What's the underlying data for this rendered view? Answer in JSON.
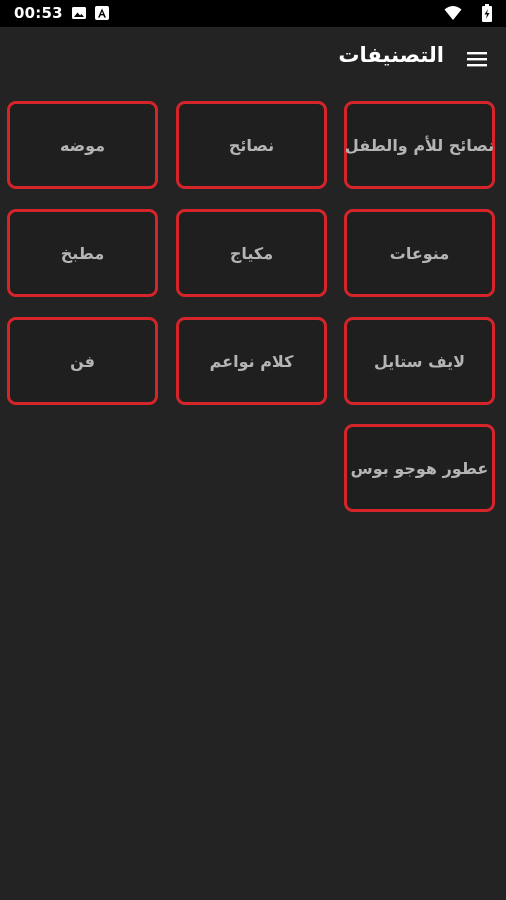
{
  "status_bar": {
    "time": "00:53",
    "icons": [
      "image-icon",
      "notification-a-icon",
      "wifi-icon",
      "battery-icon"
    ]
  },
  "app_bar": {
    "title": "التصنيفات",
    "menu_icon": "hamburger-menu-icon"
  },
  "categories": [
    {
      "label": "نصائح للأم والطفل"
    },
    {
      "label": "نصائح"
    },
    {
      "label": "موضه"
    },
    {
      "label": "منوعات"
    },
    {
      "label": "مكياج"
    },
    {
      "label": "مطبخ"
    },
    {
      "label": "لايف ستايل"
    },
    {
      "label": "كلام نواعم"
    },
    {
      "label": "فن"
    },
    {
      "label": "عطور هوجو بوس"
    }
  ],
  "colors": {
    "background": "#232323",
    "status_bar": "#000000",
    "tile_border": "#d6242b",
    "tile_background": "#1f1f1f",
    "tile_text": "#b4b4b4",
    "title_text": "#ffffff"
  }
}
